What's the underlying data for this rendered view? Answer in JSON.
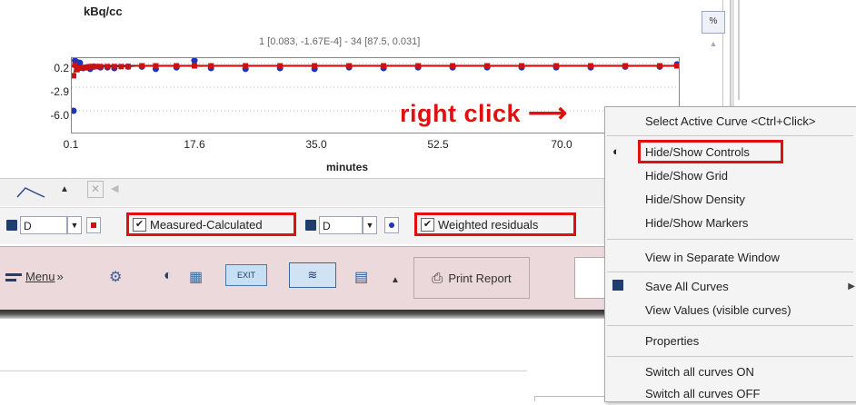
{
  "plot": {
    "y_axis_label": "kBq/cc",
    "readout": "1 [0.083, -1.67E-4] - 34 [87.5, 0.031]",
    "y_ticks": [
      "0.2",
      "-2.9",
      "-6.0"
    ],
    "x_ticks": [
      "0.1",
      "17.6",
      "35.0",
      "52.5",
      "70.0"
    ],
    "x_axis_label": "minutes",
    "percent_button": "%",
    "marker_colors": {
      "measured": "#cc1111",
      "calculated": "#2233bb"
    }
  },
  "chart_data": {
    "type": "scatter",
    "title": "",
    "xlabel": "minutes",
    "ylabel": "kBq/cc",
    "xlim": [
      0.1,
      87.5
    ],
    "ylim": [
      -6.0,
      0.2
    ],
    "series": [
      {
        "name": "Measured-Calculated",
        "color": "#cc1111",
        "x": [
          0.1,
          0.3,
          0.6,
          1,
          1.5,
          2,
          2.5,
          3,
          3.5,
          4,
          5,
          6,
          7,
          8,
          10,
          12,
          15,
          17.6,
          20,
          25,
          30,
          35,
          40,
          45,
          50,
          55,
          60,
          65,
          70,
          75,
          80,
          85,
          87.5
        ],
        "y": [
          -1.4,
          0.0,
          -0.6,
          -0.4,
          -0.3,
          -0.3,
          -0.2,
          -0.2,
          -0.2,
          -0.2,
          -0.2,
          -0.2,
          -0.2,
          -0.2,
          -0.1,
          -0.1,
          -0.1,
          -0.1,
          -0.1,
          -0.1,
          -0.1,
          -0.1,
          -0.1,
          -0.1,
          -0.1,
          -0.1,
          -0.1,
          -0.1,
          -0.1,
          -0.1,
          -0.1,
          -0.1,
          -0.1
        ]
      },
      {
        "name": "Weighted residuals",
        "color": "#2233bb",
        "x": [
          0.1,
          0.3,
          0.6,
          1,
          1.5,
          2,
          2.5,
          3,
          4,
          5,
          6,
          8,
          10,
          12,
          15,
          17.6,
          20,
          25,
          30,
          35,
          40,
          45,
          50,
          55,
          60,
          65,
          70,
          75,
          80,
          85,
          87.5
        ],
        "y": [
          -6.0,
          0.6,
          0.4,
          0.3,
          -0.4,
          -0.3,
          -0.5,
          -0.2,
          -0.3,
          -0.3,
          -0.4,
          -0.2,
          -0.2,
          -0.5,
          -0.3,
          0.6,
          -0.4,
          -0.5,
          -0.4,
          -0.5,
          -0.3,
          -0.4,
          -0.3,
          -0.3,
          -0.3,
          -0.3,
          -0.3,
          -0.3,
          -0.2,
          -0.2,
          0.1
        ]
      }
    ]
  },
  "controls": {
    "left_dropdown": "D",
    "left_checkbox_label": "Measured-Calculated",
    "left_checked": true,
    "right_dropdown": "D",
    "right_checkbox_label": "Weighted residuals",
    "right_checked": true,
    "checkbox_mark": "✔",
    "dropdown_arrow": "▼"
  },
  "toolbar": {
    "menu_label": "Menu",
    "menu_suffix": "»",
    "print_label": "Print Report",
    "exit_label": "EXIT",
    "expand_arrow": "▲"
  },
  "annotation": {
    "text": "right click",
    "arrow": "⟶",
    "color": "#e01010"
  },
  "context_menu": {
    "items": [
      {
        "label": "Select Active Curve <Ctrl+Click>"
      },
      {
        "label": "Hide/Show Controls",
        "icon": "contrast-icon"
      },
      {
        "label": "Hide/Show Grid"
      },
      {
        "label": "Hide/Show Density"
      },
      {
        "label": "Hide/Show Markers"
      },
      {
        "label": "View in Separate Window"
      },
      {
        "label": "Save All Curves",
        "icon": "disk-icon",
        "submenu_arrow": "▶"
      },
      {
        "label": "View Values (visible curves)"
      },
      {
        "label": "Properties"
      },
      {
        "label": "Switch all curves ON"
      },
      {
        "label": "Switch all curves OFF"
      }
    ]
  }
}
